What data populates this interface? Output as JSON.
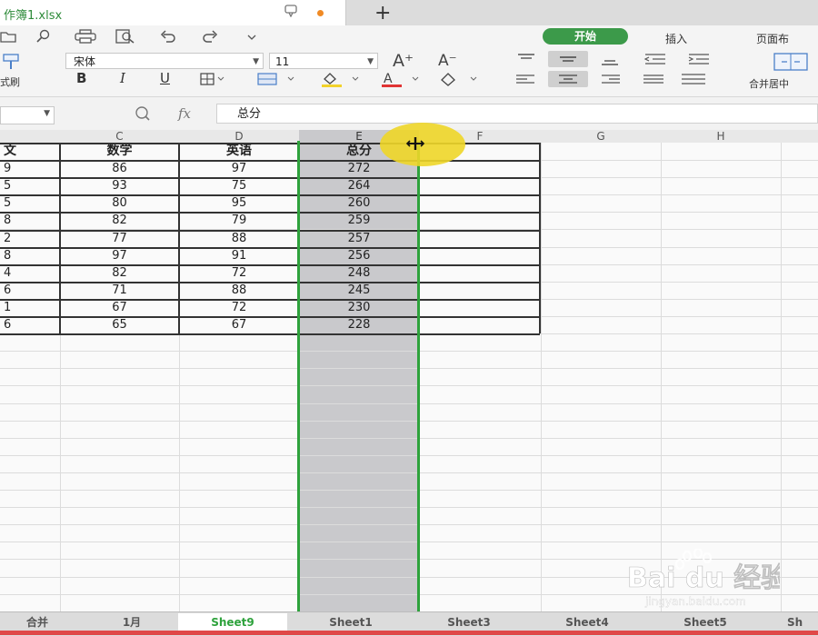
{
  "window": {
    "doc_title": "作簿1.xlsx",
    "new_tab": "+"
  },
  "ribbon": {
    "tabs": [
      "开始",
      "插入",
      "页面布"
    ],
    "font_name": "宋体",
    "font_size": "11",
    "format_painter_partial": "式刷",
    "merge_center_label": "合并居中"
  },
  "formula_bar": {
    "fx_label": "fx",
    "value": "总分"
  },
  "grid": {
    "col_headers": [
      "C",
      "D",
      "E",
      "F",
      "G",
      "H"
    ],
    "headers": [
      "文",
      "数学",
      "英语",
      "总分"
    ],
    "rows": [
      [
        "9",
        "86",
        "97",
        "272"
      ],
      [
        "5",
        "93",
        "75",
        "264"
      ],
      [
        "5",
        "80",
        "95",
        "260"
      ],
      [
        "8",
        "82",
        "79",
        "259"
      ],
      [
        "2",
        "77",
        "88",
        "257"
      ],
      [
        "8",
        "97",
        "91",
        "256"
      ],
      [
        "4",
        "82",
        "72",
        "248"
      ],
      [
        "6",
        "71",
        "88",
        "245"
      ],
      [
        "1",
        "67",
        "72",
        "230"
      ],
      [
        "6",
        "65",
        "67",
        "228"
      ]
    ]
  },
  "sheets": {
    "tabs": [
      "合并",
      "1月",
      "Sheet9",
      "Sheet1",
      "Sheet3",
      "Sheet4",
      "Sheet5",
      "Sh"
    ],
    "active": "Sheet9"
  },
  "watermark": {
    "brand": "Bai du 经验",
    "url": "jingyan.baidu.com"
  },
  "colors": {
    "accent": "#2ea23c",
    "selection": "#c9c9cc",
    "highlight": "#eed628"
  }
}
